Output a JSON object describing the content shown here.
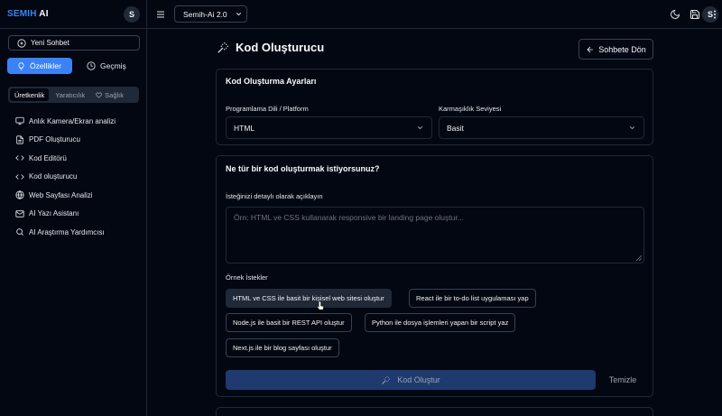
{
  "sidebar": {
    "brand_primary": "SEMIH",
    "brand_secondary": "AI",
    "avatar_initial": "S",
    "new_chat_label": "Yeni Sohbet",
    "mode_tabs": [
      {
        "label": "Özellikler",
        "active": true,
        "icon": "lightbulb-icon"
      },
      {
        "label": "Geçmiş",
        "active": false,
        "icon": "clock-icon"
      }
    ],
    "category_tabs": [
      {
        "label": "Üretkenlik",
        "active": true
      },
      {
        "label": "Yaratıcılık",
        "active": false
      },
      {
        "label": "Sağlık",
        "active": false,
        "icon": "heart-icon"
      }
    ],
    "items": [
      {
        "label": "Anlık Kamera/Ekran analizi",
        "icon": "monitor-icon"
      },
      {
        "label": "PDF Oluşturucu",
        "icon": "file-icon"
      },
      {
        "label": "Kod Editörü",
        "icon": "code-icon"
      },
      {
        "label": "Kod oluşturucu",
        "icon": "code-icon"
      },
      {
        "label": "Web Sayfası Analizi",
        "icon": "globe-icon"
      },
      {
        "label": "AI Yazı Asistanı",
        "icon": "mail-icon"
      },
      {
        "label": "AI Araştırma Yardımcısı",
        "icon": "search-icon"
      }
    ]
  },
  "topbar": {
    "model_label": "Semih-Ai 2.0",
    "avatar_initial": "S",
    "icons": [
      "menu-icon",
      "chevron-down-icon",
      "moon-icon",
      "save-icon",
      "more-vertical-icon"
    ]
  },
  "main": {
    "title": "Kod Oluşturucu",
    "back_label": "Sohbete Dön",
    "settings": {
      "heading": "Kod Oluşturma Ayarları",
      "language_label": "Programlama Dili / Platform",
      "language_value": "HTML",
      "complexity_label": "Karmaşıklık Seviyesi",
      "complexity_value": "Basit"
    },
    "request": {
      "heading": "Ne tür bir kod oluşturmak istiyorsunuz?",
      "description_label": "İsteğinizi detaylı olarak açıklayın",
      "description_placeholder": "Örn: HTML ve CSS kullanarak responsive bir landing page oluştur...",
      "examples_label": "Örnek İstekler",
      "examples": [
        "HTML ve CSS ile basit bir kişisel web sitesi oluştur",
        "React ile bir to-do list uygulaması yap",
        "Node.js ile basit bir REST API oluştur",
        "Python ile dosya işlemleri yapan bir script yaz",
        "Next.js ile bir blog sayfası oluştur"
      ],
      "generate_label": "Kod Oluştur",
      "clear_label": "Temizle"
    }
  },
  "colors": {
    "background": "#030712",
    "accent": "#3b82f6",
    "border": "#1f2937",
    "generate_disabled": "#1e3a6e"
  }
}
